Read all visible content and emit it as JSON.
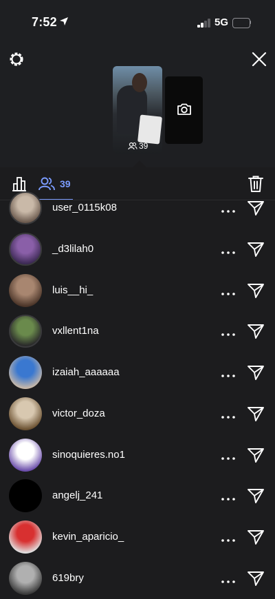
{
  "status_bar": {
    "time": "7:52",
    "network": "5G",
    "location_icon": "location-arrow-icon",
    "battery_color": "#f2d44a"
  },
  "header": {
    "settings_icon": "gear-icon",
    "close_icon": "close-icon"
  },
  "story": {
    "viewer_count": "39",
    "viewer_icon": "viewers-icon",
    "camera_icon": "camera-icon"
  },
  "tabs": {
    "insights_icon": "bar-chart-icon",
    "viewers_icon": "viewers-icon",
    "viewers_count": "39",
    "delete_icon": "trash-icon",
    "active_color": "#7b9cff"
  },
  "viewers": [
    {
      "username": "user_0115k08",
      "avatar_colors": [
        "#c9b9a8",
        "#6b5a4e"
      ]
    },
    {
      "username": "_d3lilah0",
      "avatar_colors": [
        "#8a5fa8",
        "#3d2a55"
      ]
    },
    {
      "username": "luis__hi_",
      "avatar_colors": [
        "#a88670",
        "#4a3428"
      ]
    },
    {
      "username": "vxllent1na",
      "avatar_colors": [
        "#6a8a4c",
        "#2a2a2a"
      ]
    },
    {
      "username": "izaiah_aaaaaa",
      "avatar_colors": [
        "#3a78d0",
        "#c8b8a8"
      ]
    },
    {
      "username": "victor_doza",
      "avatar_colors": [
        "#d8c8b0",
        "#6a5030"
      ]
    },
    {
      "username": "sinoquieres.no1",
      "avatar_colors": [
        "#ffffff",
        "#6a4caa"
      ]
    },
    {
      "username": "angelj_241",
      "avatar_colors": [
        "#000000",
        "#000000"
      ]
    },
    {
      "username": "kevin_aparicio_",
      "avatar_colors": [
        "#d83030",
        "#e0e0e0"
      ]
    },
    {
      "username": "619bry",
      "avatar_colors": [
        "#b0b0b0",
        "#3a3a3a"
      ]
    }
  ],
  "row_actions": {
    "more_icon": "more-horizontal-icon",
    "send_icon": "send-icon"
  }
}
